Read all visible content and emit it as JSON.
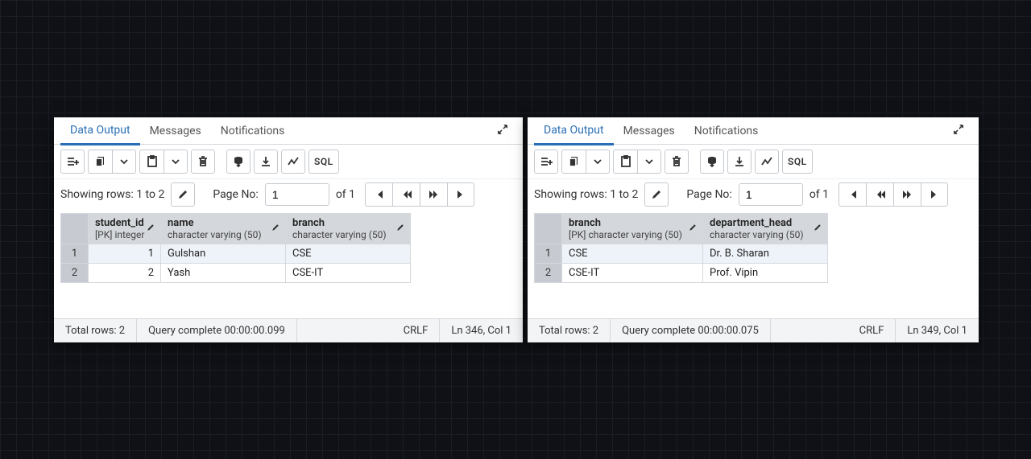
{
  "left": {
    "tabs": [
      "Data Output",
      "Messages",
      "Notifications"
    ],
    "activeTab": 0,
    "showing": "Showing rows: 1 to 2",
    "pageLabel": "Page No:",
    "pageValue": "1",
    "pageOf": "of 1",
    "columns": [
      {
        "name": "student_id",
        "type": "[PK] integer"
      },
      {
        "name": "name",
        "type": "character varying (50)"
      },
      {
        "name": "branch",
        "type": "character varying (50)"
      }
    ],
    "rows": [
      {
        "n": "1",
        "cells": [
          "1",
          "Gulshan",
          "CSE"
        ]
      },
      {
        "n": "2",
        "cells": [
          "2",
          "Yash",
          "CSE-IT"
        ]
      }
    ],
    "status": {
      "total": "Total rows: 2",
      "query": "Query complete 00:00:00.099",
      "eol": "CRLF",
      "pos": "Ln 346, Col 1"
    }
  },
  "right": {
    "tabs": [
      "Data Output",
      "Messages",
      "Notifications"
    ],
    "activeTab": 0,
    "showing": "Showing rows: 1 to 2",
    "pageLabel": "Page No:",
    "pageValue": "1",
    "pageOf": "of 1",
    "columns": [
      {
        "name": "branch",
        "type": "[PK] character varying (50)"
      },
      {
        "name": "department_head",
        "type": "character varying (50)"
      }
    ],
    "rows": [
      {
        "n": "1",
        "cells": [
          "CSE",
          "Dr. B. Sharan"
        ]
      },
      {
        "n": "2",
        "cells": [
          "CSE-IT",
          "Prof. Vipin"
        ]
      }
    ],
    "status": {
      "total": "Total rows: 2",
      "query": "Query complete 00:00:00.075",
      "eol": "CRLF",
      "pos": "Ln 349, Col 1"
    }
  },
  "sqlLabel": "SQL"
}
